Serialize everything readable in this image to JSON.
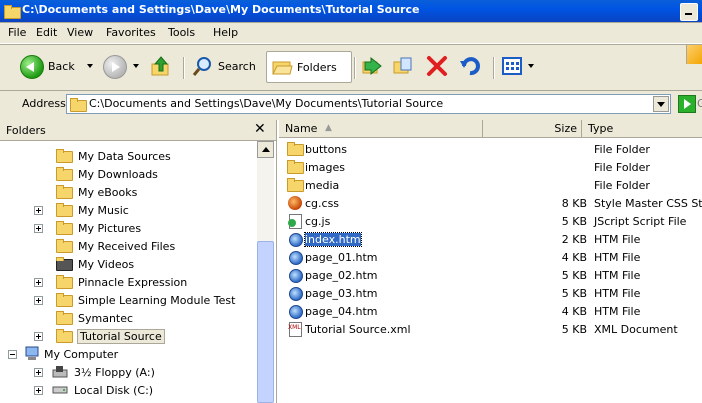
{
  "window": {
    "title": "C:\\Documents and Settings\\Dave\\My Documents\\Tutorial Source"
  },
  "menu": [
    "File",
    "Edit",
    "View",
    "Favorites",
    "Tools",
    "Help"
  ],
  "toolbar": {
    "back": "Back",
    "search": "Search",
    "folders": "Folders"
  },
  "address": {
    "label": "Address",
    "value": "C:\\Documents and Settings\\Dave\\My Documents\\Tutorial Source",
    "go_partial": "G"
  },
  "folders_pane": {
    "title": "Folders",
    "close": "✕",
    "items": [
      {
        "label": "My Data Sources",
        "expander": "",
        "level": 2
      },
      {
        "label": "My Downloads",
        "expander": "",
        "level": 2
      },
      {
        "label": "My eBooks",
        "expander": "",
        "level": 2
      },
      {
        "label": "My Music",
        "expander": "plus",
        "level": 2
      },
      {
        "label": "My Pictures",
        "expander": "plus",
        "level": 2
      },
      {
        "label": "My Received Files",
        "expander": "",
        "level": 2
      },
      {
        "label": "My Videos",
        "expander": "",
        "level": 2
      },
      {
        "label": "Pinnacle Expression",
        "expander": "plus",
        "level": 2
      },
      {
        "label": "Simple Learning Module Test",
        "expander": "plus",
        "level": 2
      },
      {
        "label": "Symantec",
        "expander": "",
        "level": 2
      },
      {
        "label": "Tutorial Source",
        "expander": "plus",
        "level": 2,
        "selected": true
      },
      {
        "label": "My Computer",
        "expander": "minus",
        "level": 1
      },
      {
        "label": "3½ Floppy (A:)",
        "expander": "plus",
        "level": 2
      },
      {
        "label": "Local Disk (C:)",
        "expander": "plus",
        "level": 2
      }
    ]
  },
  "files_pane": {
    "columns": {
      "name": "Name",
      "size": "Size",
      "type": "Type"
    },
    "files": [
      {
        "name": "buttons",
        "size": "",
        "type": "File Folder",
        "icon": "folder-icon"
      },
      {
        "name": "images",
        "size": "",
        "type": "File Folder",
        "icon": "folder-icon"
      },
      {
        "name": "media",
        "size": "",
        "type": "File Folder",
        "icon": "folder-icon"
      },
      {
        "name": "cg.css",
        "size": "8 KB",
        "type": "Style Master CSS St...",
        "icon": "css-file-icon"
      },
      {
        "name": "cg.js",
        "size": "5 KB",
        "type": "JScript Script File",
        "icon": "js-file-icon"
      },
      {
        "name": "index.htm",
        "size": "2 KB",
        "type": "HTM File",
        "icon": "htm-file-icon",
        "selected": true
      },
      {
        "name": "page_01.htm",
        "size": "4 KB",
        "type": "HTM File",
        "icon": "htm-file-icon"
      },
      {
        "name": "page_02.htm",
        "size": "5 KB",
        "type": "HTM File",
        "icon": "htm-file-icon"
      },
      {
        "name": "page_03.htm",
        "size": "5 KB",
        "type": "HTM File",
        "icon": "htm-file-icon"
      },
      {
        "name": "page_04.htm",
        "size": "4 KB",
        "type": "HTM File",
        "icon": "htm-file-icon"
      },
      {
        "name": "Tutorial Source.xml",
        "size": "5 KB",
        "type": "XML Document",
        "icon": "xml-file-icon"
      }
    ]
  }
}
